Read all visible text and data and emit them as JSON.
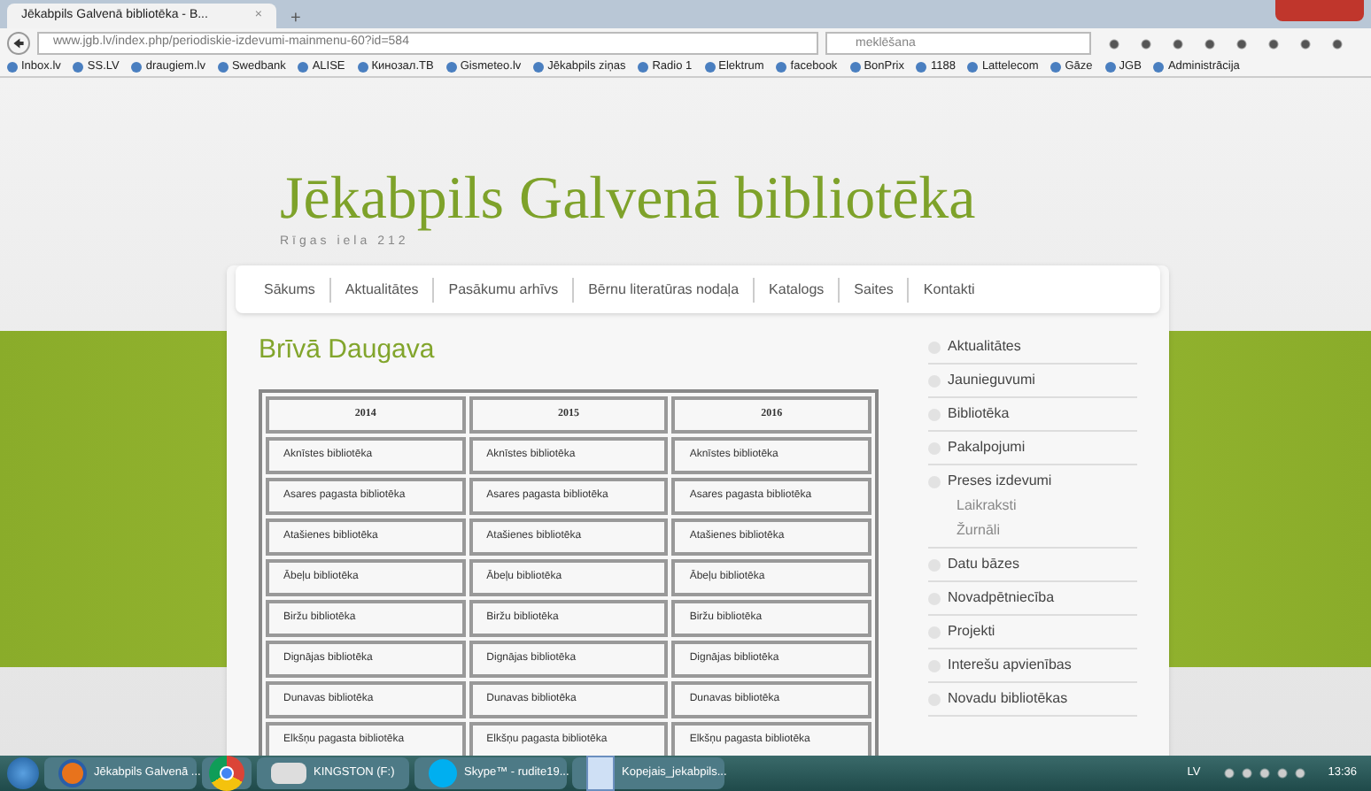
{
  "browser": {
    "tab_title": "Jēkabpils Galvenā bibliotēka - B...",
    "tab_close": "×",
    "new_tab": "+",
    "url": "www.jgb.lv/index.php/periodiskie-izdevumi-mainmenu-60?id=584",
    "search_placeholder": "meklēšana",
    "bookmarks": [
      "Inbox.lv",
      "SS.LV",
      "draugiem.lv",
      "Swedbank",
      "ALISE",
      "Кинозал.ТВ",
      "Gismeteo.lv",
      "Jēkabpils ziņas",
      "Radio 1",
      "Elektrum",
      "facebook",
      "BonPrix",
      "1188",
      "Lattelecom",
      "Gāze",
      "JGB",
      "Administrācija"
    ]
  },
  "site": {
    "title": "Jēkabpils Galvenā bibliotēka",
    "address": "Rīgas iela 212",
    "nav": [
      {
        "label": "Sākums"
      },
      {
        "label": "Aktualitātes"
      },
      {
        "label": "Pasākumu arhīvs"
      },
      {
        "label": "Bērnu literatūras nodaļa"
      },
      {
        "label": "Katalogs"
      },
      {
        "label": "Saites"
      },
      {
        "label": "Kontakti"
      }
    ],
    "heading": "Brīvā Daugava",
    "table": {
      "columns": [
        "2014",
        "2015",
        "2016"
      ],
      "rows": [
        [
          "Aknīstes bibliotēka",
          "Aknīstes bibliotēka",
          "Aknīstes bibliotēka"
        ],
        [
          "Asares pagasta bibliotēka",
          "Asares pagasta bibliotēka",
          "Asares pagasta bibliotēka"
        ],
        [
          "Atašienes bibliotēka",
          "Atašienes bibliotēka",
          "Atašienes bibliotēka"
        ],
        [
          "Ābeļu bibliotēka",
          "Ābeļu bibliotēka",
          "Ābeļu bibliotēka"
        ],
        [
          "Biržu bibliotēka",
          "Biržu bibliotēka",
          "Biržu bibliotēka"
        ],
        [
          "Dignājas bibliotēka",
          "Dignājas bibliotēka",
          "Dignājas bibliotēka"
        ],
        [
          "Dunavas bibliotēka",
          "Dunavas bibliotēka",
          "Dunavas bibliotēka"
        ],
        [
          "Elkšņu pagasta bibliotēka",
          "Elkšņu pagasta bibliotēka",
          "Elkšņu pagasta bibliotēka"
        ]
      ]
    },
    "sidebar": {
      "items": [
        {
          "label": "Aktualitātes"
        },
        {
          "label": "Jaunieguvumi"
        },
        {
          "label": "Bibliotēka"
        },
        {
          "label": "Pakalpojumi"
        },
        {
          "label": "Preses izdevumi",
          "children": [
            {
              "label": "Laikraksti"
            },
            {
              "label": "Žurnāli"
            }
          ]
        },
        {
          "label": "Datu bāzes"
        },
        {
          "label": "Novadpētniecība"
        },
        {
          "label": "Projekti"
        },
        {
          "label": "Interešu apvienības"
        },
        {
          "label": "Novadu bibliotēkas"
        }
      ]
    }
  },
  "taskbar": {
    "items": [
      {
        "label": "Jēkabpils Galvenā ...",
        "kind": "firefox"
      },
      {
        "kind": "chrome"
      },
      {
        "label": "KINGSTON (F:)",
        "kind": "drive"
      },
      {
        "label": "Skype™ - rudite19...",
        "kind": "skype"
      },
      {
        "label": "Kopejais_jekabpils...",
        "kind": "document"
      }
    ],
    "language": "LV",
    "time": "13:36"
  }
}
